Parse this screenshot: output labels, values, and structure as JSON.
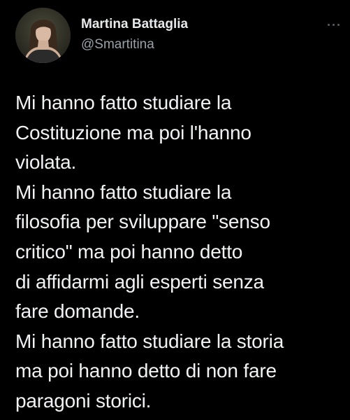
{
  "author": {
    "display_name": "Martina Battaglia",
    "handle": "@Smartitina",
    "avatar_icon": "profile-photo"
  },
  "more_icon": "more-dots-icon",
  "tweet": {
    "lines": [
      "Mi hanno fatto studiare la",
      "Costituzione ma poi l'hanno",
      "violata.",
      "Mi hanno fatto studiare la",
      "filosofia per sviluppare \"senso",
      "critico\" ma poi hanno detto",
      "di affidarmi agli esperti senza",
      "fare domande.",
      "Mi hanno fatto studiare la storia",
      "ma poi hanno detto di non fare",
      "paragoni storici."
    ]
  },
  "colors": {
    "background": "#000000",
    "primary_text": "#e7e9ea",
    "secondary_text": "#9aa1a8"
  }
}
